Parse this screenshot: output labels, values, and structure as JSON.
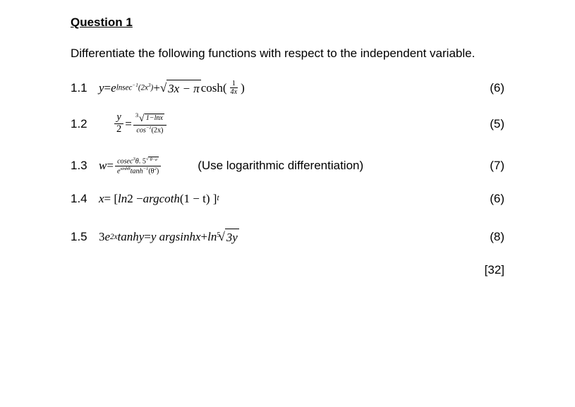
{
  "title": "Question 1",
  "intro": "Differentiate the following functions with respect to the independent variable.",
  "q": {
    "n1": "1.1",
    "n2": "1.2",
    "n3": "1.3",
    "n4": "1.4",
    "n5": "1.5"
  },
  "marks": {
    "m1": "(6)",
    "m2": "(5)",
    "m3": "(7)",
    "m4": "(6)",
    "m5": "(8)"
  },
  "hint": "(Use logarithmic differentiation)",
  "total": "[32]",
  "math": {
    "q1_y": "y",
    "q1_eq": " = ",
    "q1_e": "e",
    "q1_exp1a": "lnsec",
    "q1_exp1b": "−1",
    "q1_exp1c": "(2x",
    "q1_exp1d": "3",
    "q1_exp1e": ")",
    "q1_plus": " + ",
    "q1_sqrt_body": "3x − π",
    "q1_cosh": " cosh(",
    "q1_frac_num": "1",
    "q1_frac_den": "4x",
    "q1_close": ")",
    "q2_frac_num": "y",
    "q2_frac_den": "2",
    "q2_eq": " = ",
    "q2_num_root": "3",
    "q2_num_body": "1−lnx",
    "q2_den_cos": "cos",
    "q2_den_sup": "−1",
    "q2_den_arg": "(2x)",
    "q3_w": "w",
    "q3_eq": " = ",
    "q3_num_cosec": "cosec",
    "q3_num_sup": "3",
    "q3_num_theta": "θ",
    "q3_num_dot": ".  5",
    "q3_num_sqrt": "θ−e",
    "q3_den_e": "e",
    "q3_den_sinh": "sinhθ",
    "q3_den_tanh": "tanh",
    "q3_den_sup2": "−1",
    "q3_den_arg": "(θ",
    "q3_den_sq": "2",
    "q3_den_close": ")",
    "q4_x": "x",
    "q4_eq": " = [ ",
    "q4_ln2": "ln",
    "q4_two": "2 − ",
    "q4_arg": "argcoth",
    "q4_paren": "(1 − t) ]",
    "q4_sup": "t",
    "q5_lhs1": "3e",
    "q5_lhs_sup": "2x",
    "q5_tanhy": "tanhy",
    "q5_eq": " = ",
    "q5_rhs1": " y argsinhx",
    "q5_plus": " + ",
    "q5_ln": "ln",
    "q5_root": "5",
    "q5_body": "3y"
  }
}
